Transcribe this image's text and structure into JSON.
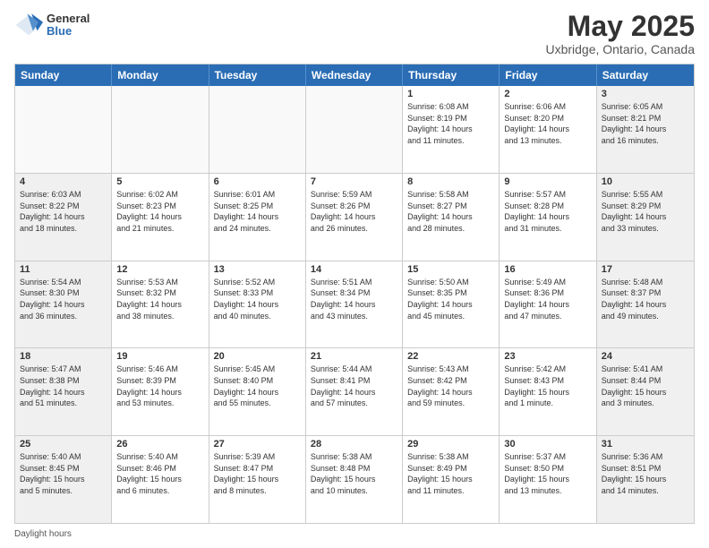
{
  "header": {
    "logo_general": "General",
    "logo_blue": "Blue",
    "month_title": "May 2025",
    "subtitle": "Uxbridge, Ontario, Canada"
  },
  "calendar": {
    "days": [
      "Sunday",
      "Monday",
      "Tuesday",
      "Wednesday",
      "Thursday",
      "Friday",
      "Saturday"
    ],
    "rows": [
      [
        {
          "day": "",
          "text": ""
        },
        {
          "day": "",
          "text": ""
        },
        {
          "day": "",
          "text": ""
        },
        {
          "day": "",
          "text": ""
        },
        {
          "day": "1",
          "text": "Sunrise: 6:08 AM\nSunset: 8:19 PM\nDaylight: 14 hours\nand 11 minutes."
        },
        {
          "day": "2",
          "text": "Sunrise: 6:06 AM\nSunset: 8:20 PM\nDaylight: 14 hours\nand 13 minutes."
        },
        {
          "day": "3",
          "text": "Sunrise: 6:05 AM\nSunset: 8:21 PM\nDaylight: 14 hours\nand 16 minutes."
        }
      ],
      [
        {
          "day": "4",
          "text": "Sunrise: 6:03 AM\nSunset: 8:22 PM\nDaylight: 14 hours\nand 18 minutes."
        },
        {
          "day": "5",
          "text": "Sunrise: 6:02 AM\nSunset: 8:23 PM\nDaylight: 14 hours\nand 21 minutes."
        },
        {
          "day": "6",
          "text": "Sunrise: 6:01 AM\nSunset: 8:25 PM\nDaylight: 14 hours\nand 24 minutes."
        },
        {
          "day": "7",
          "text": "Sunrise: 5:59 AM\nSunset: 8:26 PM\nDaylight: 14 hours\nand 26 minutes."
        },
        {
          "day": "8",
          "text": "Sunrise: 5:58 AM\nSunset: 8:27 PM\nDaylight: 14 hours\nand 28 minutes."
        },
        {
          "day": "9",
          "text": "Sunrise: 5:57 AM\nSunset: 8:28 PM\nDaylight: 14 hours\nand 31 minutes."
        },
        {
          "day": "10",
          "text": "Sunrise: 5:55 AM\nSunset: 8:29 PM\nDaylight: 14 hours\nand 33 minutes."
        }
      ],
      [
        {
          "day": "11",
          "text": "Sunrise: 5:54 AM\nSunset: 8:30 PM\nDaylight: 14 hours\nand 36 minutes."
        },
        {
          "day": "12",
          "text": "Sunrise: 5:53 AM\nSunset: 8:32 PM\nDaylight: 14 hours\nand 38 minutes."
        },
        {
          "day": "13",
          "text": "Sunrise: 5:52 AM\nSunset: 8:33 PM\nDaylight: 14 hours\nand 40 minutes."
        },
        {
          "day": "14",
          "text": "Sunrise: 5:51 AM\nSunset: 8:34 PM\nDaylight: 14 hours\nand 43 minutes."
        },
        {
          "day": "15",
          "text": "Sunrise: 5:50 AM\nSunset: 8:35 PM\nDaylight: 14 hours\nand 45 minutes."
        },
        {
          "day": "16",
          "text": "Sunrise: 5:49 AM\nSunset: 8:36 PM\nDaylight: 14 hours\nand 47 minutes."
        },
        {
          "day": "17",
          "text": "Sunrise: 5:48 AM\nSunset: 8:37 PM\nDaylight: 14 hours\nand 49 minutes."
        }
      ],
      [
        {
          "day": "18",
          "text": "Sunrise: 5:47 AM\nSunset: 8:38 PM\nDaylight: 14 hours\nand 51 minutes."
        },
        {
          "day": "19",
          "text": "Sunrise: 5:46 AM\nSunset: 8:39 PM\nDaylight: 14 hours\nand 53 minutes."
        },
        {
          "day": "20",
          "text": "Sunrise: 5:45 AM\nSunset: 8:40 PM\nDaylight: 14 hours\nand 55 minutes."
        },
        {
          "day": "21",
          "text": "Sunrise: 5:44 AM\nSunset: 8:41 PM\nDaylight: 14 hours\nand 57 minutes."
        },
        {
          "day": "22",
          "text": "Sunrise: 5:43 AM\nSunset: 8:42 PM\nDaylight: 14 hours\nand 59 minutes."
        },
        {
          "day": "23",
          "text": "Sunrise: 5:42 AM\nSunset: 8:43 PM\nDaylight: 15 hours\nand 1 minute."
        },
        {
          "day": "24",
          "text": "Sunrise: 5:41 AM\nSunset: 8:44 PM\nDaylight: 15 hours\nand 3 minutes."
        }
      ],
      [
        {
          "day": "25",
          "text": "Sunrise: 5:40 AM\nSunset: 8:45 PM\nDaylight: 15 hours\nand 5 minutes."
        },
        {
          "day": "26",
          "text": "Sunrise: 5:40 AM\nSunset: 8:46 PM\nDaylight: 15 hours\nand 6 minutes."
        },
        {
          "day": "27",
          "text": "Sunrise: 5:39 AM\nSunset: 8:47 PM\nDaylight: 15 hours\nand 8 minutes."
        },
        {
          "day": "28",
          "text": "Sunrise: 5:38 AM\nSunset: 8:48 PM\nDaylight: 15 hours\nand 10 minutes."
        },
        {
          "day": "29",
          "text": "Sunrise: 5:38 AM\nSunset: 8:49 PM\nDaylight: 15 hours\nand 11 minutes."
        },
        {
          "day": "30",
          "text": "Sunrise: 5:37 AM\nSunset: 8:50 PM\nDaylight: 15 hours\nand 13 minutes."
        },
        {
          "day": "31",
          "text": "Sunrise: 5:36 AM\nSunset: 8:51 PM\nDaylight: 15 hours\nand 14 minutes."
        }
      ]
    ]
  },
  "footer": {
    "label": "Daylight hours"
  }
}
